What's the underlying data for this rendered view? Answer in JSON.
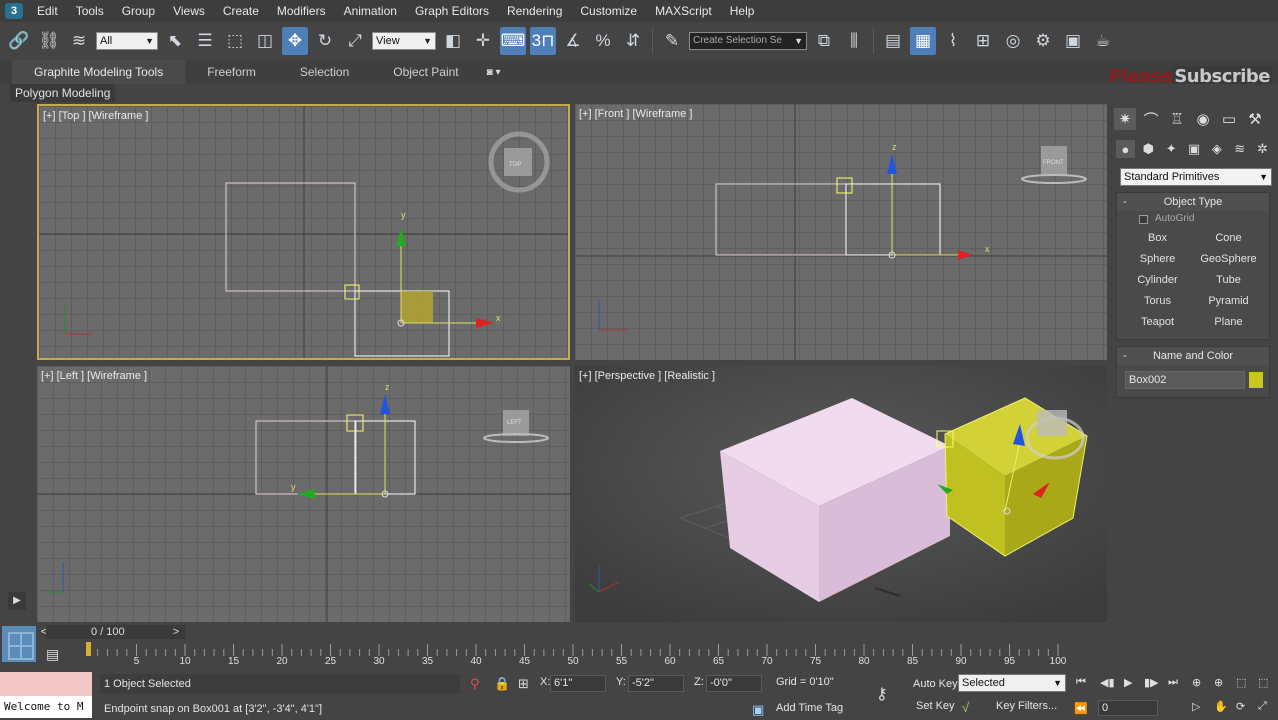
{
  "menu": {
    "logo": "3",
    "items": [
      "Edit",
      "Tools",
      "Group",
      "Views",
      "Create",
      "Modifiers",
      "Animation",
      "Graph Editors",
      "Rendering",
      "Customize",
      "MAXScript",
      "Help"
    ]
  },
  "toolbar": {
    "filter_value": "All",
    "ref_coord_value": "View",
    "snap_value": "3",
    "selection_set_placeholder": "Create Selection Se"
  },
  "ribbon": {
    "tabs": [
      "Graphite Modeling Tools",
      "Freeform",
      "Selection",
      "Object Paint"
    ],
    "active_tab": "Graphite Modeling Tools",
    "sub_label": "Polygon Modeling",
    "watermark_left": "Please",
    "watermark_right": "Subscribe"
  },
  "viewports": {
    "top": {
      "label": "[+] [Top ] [Wireframe ]",
      "cube": "TOP",
      "axis_x": "x",
      "axis_y": "y"
    },
    "front": {
      "label": "[+] [Front ] [Wireframe ]",
      "cube": "FRONT",
      "axis_x": "x",
      "axis_z": "z"
    },
    "left": {
      "label": "[+] [Left ] [Wireframe ]",
      "cube": "LEFT",
      "axis_y": "y",
      "axis_z": "z"
    },
    "perspective": {
      "label": "[+] [Perspective ] [Realistic ]"
    }
  },
  "command_panel": {
    "category_value": "Standard Primitives",
    "object_type_title": "Object Type",
    "autogrid_label": "AutoGrid",
    "buttons": [
      "Box",
      "Cone",
      "Sphere",
      "GeoSphere",
      "Cylinder",
      "Tube",
      "Torus",
      "Pyramid",
      "Teapot",
      "Plane"
    ],
    "name_color_title": "Name and Color",
    "object_name": "Box002",
    "object_color": "#c8c81e"
  },
  "timeline": {
    "frame_display": "0 / 100",
    "ticks": [
      "5",
      "10",
      "15",
      "20",
      "25",
      "30",
      "35",
      "40",
      "45",
      "50",
      "55",
      "60",
      "65",
      "70",
      "75",
      "80",
      "85",
      "90",
      "95",
      "100"
    ]
  },
  "status": {
    "welcome_text": "Welcome to M",
    "selection_info": "1 Object Selected",
    "prompt": "Endpoint snap on Box001 at [3'2\", -3'4\", 4'1\"]",
    "x_label": "X:",
    "x_value": "6'1\"",
    "y_label": "Y:",
    "y_value": "-5'2\"",
    "z_label": "Z:",
    "z_value": "-0'0\"",
    "grid": "Grid = 0'10\"",
    "add_time_tag": "Add Time Tag",
    "auto_key": "Auto Key",
    "set_key": "Set Key",
    "key_mode_value": "Selected",
    "key_filters": "Key Filters...",
    "frame_value": "0"
  },
  "colors": {
    "active_viewport_border": "#c8a94a",
    "box_pink": "#e7cfe6",
    "box_yellow": "#c8c81e",
    "accent_blue": "#4e7fb6"
  }
}
